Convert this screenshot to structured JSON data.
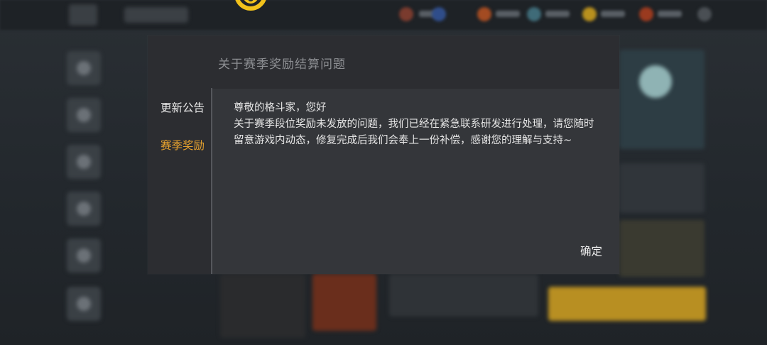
{
  "dialog": {
    "title": "关于赛季奖励结算问题",
    "tabs": [
      {
        "label": "更新公告",
        "active": false
      },
      {
        "label": "赛季奖励",
        "active": true
      }
    ],
    "message": {
      "greeting": "尊敬的格斗家，您好",
      "body": "关于赛季段位奖励未发放的问题，我们已经在紧急联系研发进行处理，请您随时留意游戏内动态，修复完成后我们会奉上一份补偿，感谢您的理解与支持~"
    },
    "confirm_label": "确定"
  },
  "colors": {
    "dialog_bg": "#2c2d31",
    "panel_bg": "#34363a",
    "active_tab": "#e6a22e",
    "logo": "#f2c21b"
  },
  "icons": {
    "logo": "game-logo-icon"
  }
}
